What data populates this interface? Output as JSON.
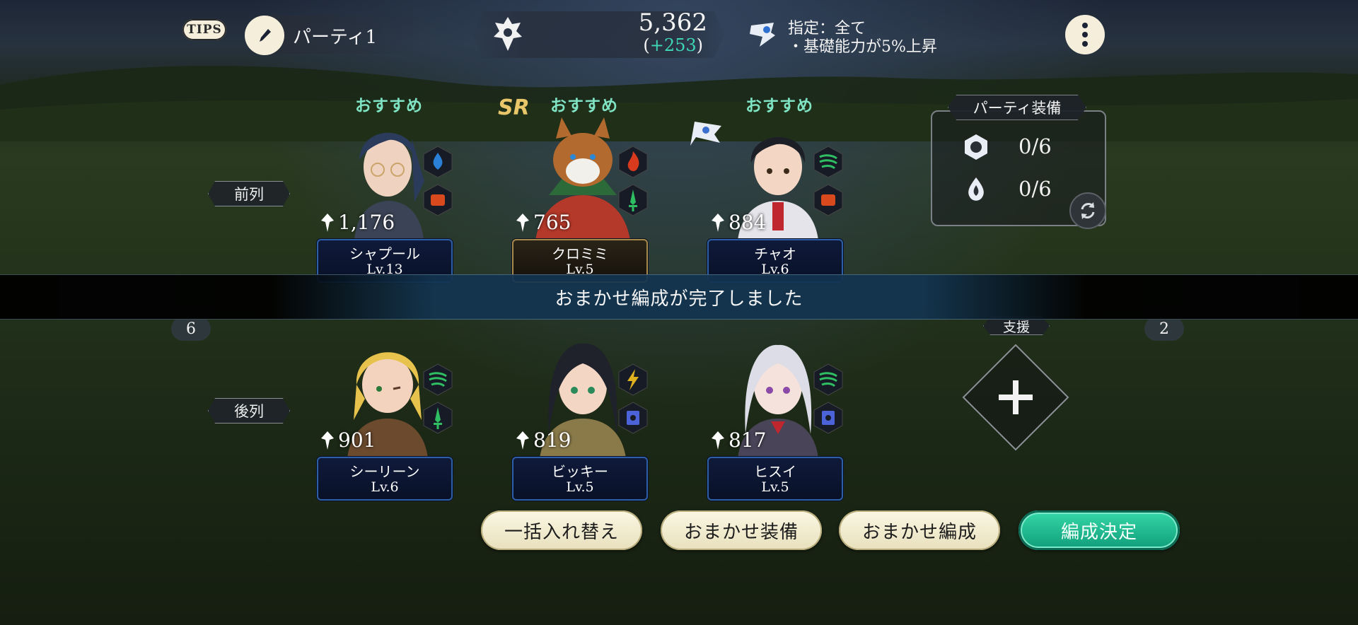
{
  "header": {
    "tips_label": "TIPS",
    "party_name": "パーティ1",
    "power_value": "5,362",
    "power_delta_open": "(",
    "power_delta_value": "+253",
    "power_delta_close": ")",
    "bonus_line1": "指定：全て",
    "bonus_line2": "・基礎能力が5%上昇"
  },
  "rows": {
    "front": "前列",
    "back": "後列"
  },
  "recommended_label": "おすすめ",
  "sr_label": "SR",
  "front_row": [
    {
      "name": "シャプール",
      "power": "1,176",
      "level": "Lv.13",
      "recommended": true,
      "element_color": "#2a7fd6",
      "role_color": "#d84a1d"
    },
    {
      "name": "クロミミ",
      "power": "765",
      "level": "Lv.5",
      "recommended": true,
      "element_color": "#d83a1d",
      "role_color": "#2fbf62"
    },
    {
      "name": "チャオ",
      "power": "884",
      "level": "Lv.6",
      "recommended": true,
      "element_color": "#2fbf62",
      "role_color": "#d84a1d"
    }
  ],
  "back_row": [
    {
      "name": "シーリーン",
      "power": "901",
      "level": "Lv.6",
      "element_color": "#2fbf62",
      "role_color": "#2fbf62"
    },
    {
      "name": "ビッキー",
      "power": "819",
      "level": "Lv.5",
      "element_color": "#e0b21e",
      "role_color": "#4b62d8"
    },
    {
      "name": "ヒスイ",
      "power": "817",
      "level": "Lv.5",
      "element_color": "#2fbf62",
      "role_color": "#4b62d8"
    }
  ],
  "toast": "おまかせ編成が完了しました",
  "counts": {
    "left": "6",
    "right": "2"
  },
  "equipment": {
    "title": "パーティ装備",
    "slot1_value": "0/6",
    "slot2_value": "0/6"
  },
  "support_label": "支援",
  "buttons": {
    "bulk_swap": "一括入れ替え",
    "auto_equip": "おまかせ装備",
    "auto_formation": "おまかせ編成",
    "confirm": "編成決定"
  },
  "colors": {
    "accent_green": "#2ccf9e",
    "recommend_text": "#7fe3c4",
    "cream": "#f4eedb"
  }
}
